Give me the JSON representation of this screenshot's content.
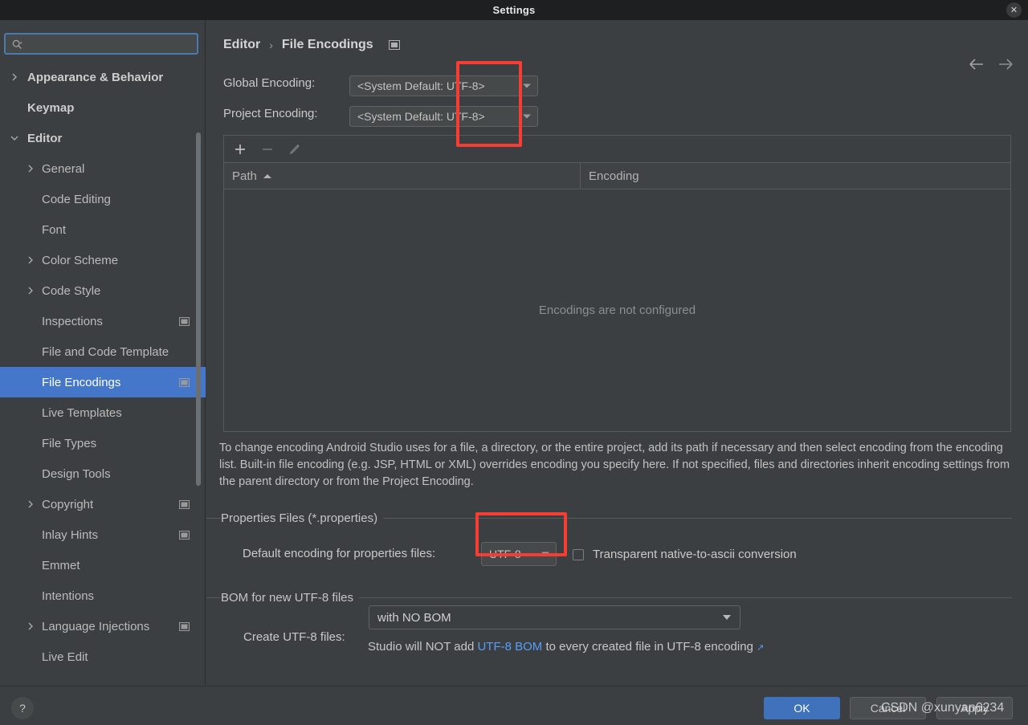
{
  "window": {
    "title": "Settings",
    "close_icon": "close-icon"
  },
  "sidebar": {
    "search": {
      "placeholder": "",
      "value": "",
      "icon": "search-icon"
    },
    "items": [
      {
        "label": "Appearance & Behavior",
        "level": 0,
        "expandable": true,
        "expanded": false,
        "selected": false,
        "badge": false
      },
      {
        "label": "Keymap",
        "level": 0,
        "expandable": false,
        "expanded": false,
        "selected": false,
        "badge": false
      },
      {
        "label": "Editor",
        "level": 0,
        "expandable": true,
        "expanded": true,
        "selected": false,
        "badge": false
      },
      {
        "label": "General",
        "level": 1,
        "expandable": true,
        "expanded": false,
        "selected": false,
        "badge": false
      },
      {
        "label": "Code Editing",
        "level": 1,
        "expandable": false,
        "expanded": false,
        "selected": false,
        "badge": false
      },
      {
        "label": "Font",
        "level": 1,
        "expandable": false,
        "expanded": false,
        "selected": false,
        "badge": false
      },
      {
        "label": "Color Scheme",
        "level": 1,
        "expandable": true,
        "expanded": false,
        "selected": false,
        "badge": false
      },
      {
        "label": "Code Style",
        "level": 1,
        "expandable": true,
        "expanded": false,
        "selected": false,
        "badge": false
      },
      {
        "label": "Inspections",
        "level": 1,
        "expandable": false,
        "expanded": false,
        "selected": false,
        "badge": true
      },
      {
        "label": "File and Code Template",
        "level": 1,
        "expandable": false,
        "expanded": false,
        "selected": false,
        "badge": false
      },
      {
        "label": "File Encodings",
        "level": 1,
        "expandable": false,
        "expanded": false,
        "selected": true,
        "badge": true
      },
      {
        "label": "Live Templates",
        "level": 1,
        "expandable": false,
        "expanded": false,
        "selected": false,
        "badge": false
      },
      {
        "label": "File Types",
        "level": 1,
        "expandable": false,
        "expanded": false,
        "selected": false,
        "badge": false
      },
      {
        "label": "Design Tools",
        "level": 1,
        "expandable": false,
        "expanded": false,
        "selected": false,
        "badge": false
      },
      {
        "label": "Copyright",
        "level": 1,
        "expandable": true,
        "expanded": false,
        "selected": false,
        "badge": true
      },
      {
        "label": "Inlay Hints",
        "level": 1,
        "expandable": false,
        "expanded": false,
        "selected": false,
        "badge": true
      },
      {
        "label": "Emmet",
        "level": 1,
        "expandable": false,
        "expanded": false,
        "selected": false,
        "badge": false
      },
      {
        "label": "Intentions",
        "level": 1,
        "expandable": false,
        "expanded": false,
        "selected": false,
        "badge": false
      },
      {
        "label": "Language Injections",
        "level": 1,
        "expandable": true,
        "expanded": false,
        "selected": false,
        "badge": true
      },
      {
        "label": "Live Edit",
        "level": 1,
        "expandable": false,
        "expanded": false,
        "selected": false,
        "badge": false
      }
    ]
  },
  "header": {
    "breadcrumb_parent": "Editor",
    "breadcrumb_separator": "›",
    "breadcrumb_current": "File Encodings",
    "project_scope_icon": "project-settings-icon",
    "back_icon": "arrow-left-icon",
    "forward_icon": "arrow-right-icon"
  },
  "encodings": {
    "global_label": "Global Encoding:",
    "global_value": "<System Default: UTF-8>",
    "project_label": "Project Encoding:",
    "project_value": "<System Default: UTF-8>",
    "toolbar": {
      "add_icon": "plus-icon",
      "remove_icon": "minus-icon",
      "edit_icon": "pencil-icon"
    },
    "columns": [
      "Path",
      "Encoding"
    ],
    "sort_column": "Path",
    "sort_direction": "asc",
    "rows": [],
    "empty_text": "Encodings are not configured",
    "description": "To change encoding Android Studio uses for a file, a directory, or the entire project, add its path if necessary and then select encoding from the encoding list. Built-in file encoding (e.g. JSP, HTML or XML) overrides encoding you specify here. If not specified, files and directories inherit encoding settings from the parent directory or from the Project Encoding."
  },
  "properties_section": {
    "title": "Properties Files (*.properties)",
    "default_encoding_label": "Default encoding for properties files:",
    "default_encoding_value": "UTF-8",
    "transparent_label": "Transparent native-to-ascii conversion",
    "transparent_checked": false
  },
  "bom_section": {
    "title": "BOM for new UTF-8 files",
    "create_label": "Create UTF-8 files:",
    "create_value": "with NO BOM",
    "note_prefix": "Studio will NOT add ",
    "note_link": "UTF-8 BOM",
    "note_suffix": " to every created file in UTF-8 encoding ",
    "note_external_icon": "↗"
  },
  "footer": {
    "help_label": "?",
    "ok_label": "OK",
    "cancel_label": "Cancel",
    "apply_label": "Apply"
  },
  "overlay": {
    "watermark": "CSDN @xunyan6234",
    "annotation_color": "#f63d34"
  }
}
